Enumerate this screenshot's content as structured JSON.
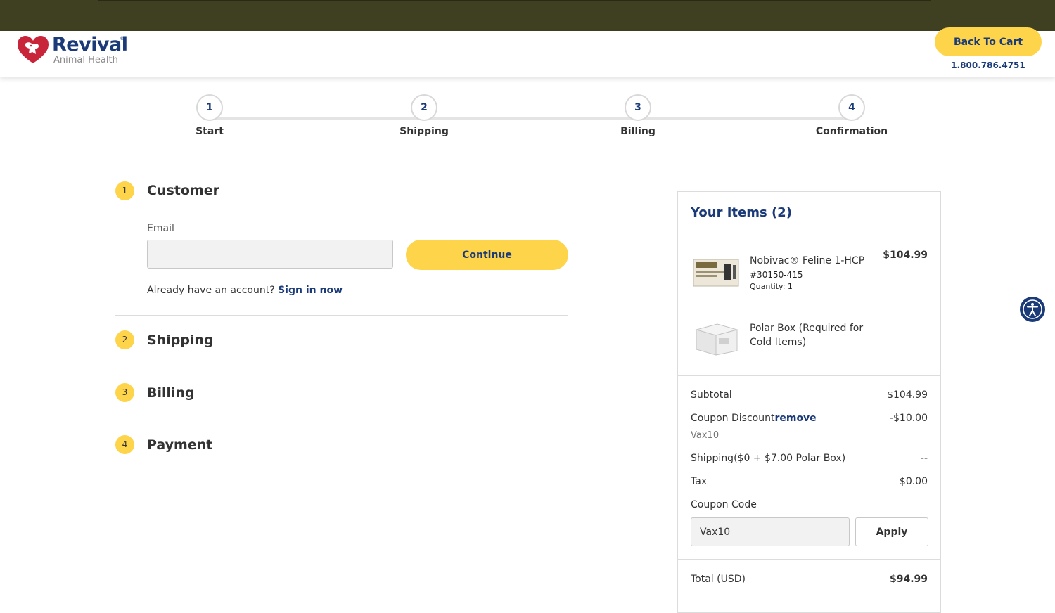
{
  "brand": {
    "name": "Revival",
    "tagline": "Animal Health",
    "trademark": "®"
  },
  "header": {
    "back_to_cart": "Back To Cart",
    "phone": "1.800.786.4751"
  },
  "progress": {
    "steps": [
      {
        "number": "1",
        "label": "Start"
      },
      {
        "number": "2",
        "label": "Shipping"
      },
      {
        "number": "3",
        "label": "Billing"
      },
      {
        "number": "4",
        "label": "Confirmation"
      }
    ]
  },
  "checkout": {
    "sections": [
      {
        "number": "1",
        "title": "Customer"
      },
      {
        "number": "2",
        "title": "Shipping"
      },
      {
        "number": "3",
        "title": "Billing"
      },
      {
        "number": "4",
        "title": "Payment"
      }
    ],
    "email_label": "Email",
    "email_value": "",
    "continue_label": "Continue",
    "already_text": "Already have an account? ",
    "sign_in_label": "Sign in now"
  },
  "summary": {
    "title": "Your Items (2)",
    "items": [
      {
        "name": "Nobivac® Feline 1-HCP",
        "sku": "#30150-415",
        "quantity": "Quantity: 1",
        "price": "$104.99",
        "image_icon": "vaccine-box-icon"
      },
      {
        "name": "Polar Box (Required for Cold Items)",
        "sku": "",
        "quantity": "",
        "price": "",
        "image_icon": "polar-box-icon"
      }
    ],
    "subtotal_label": "Subtotal",
    "subtotal_value": "$104.99",
    "coupon_discount_label": "Coupon Discount",
    "remove_label": "remove",
    "coupon_discount_value": "-$10.00",
    "coupon_applied": "Vax10",
    "shipping_label": "Shipping($0 + $7.00 Polar Box)",
    "shipping_value": "--",
    "tax_label": "Tax",
    "tax_value": "$0.00",
    "coupon_code_label": "Coupon Code",
    "coupon_code_value": "Vax10",
    "apply_label": "Apply",
    "total_label": "Total (USD)",
    "total_value": "$94.99"
  },
  "colors": {
    "accent_yellow": "#fed44a",
    "brand_navy": "#1b3a78",
    "brand_red": "#c8253a",
    "topbar": "#3f3f21"
  }
}
